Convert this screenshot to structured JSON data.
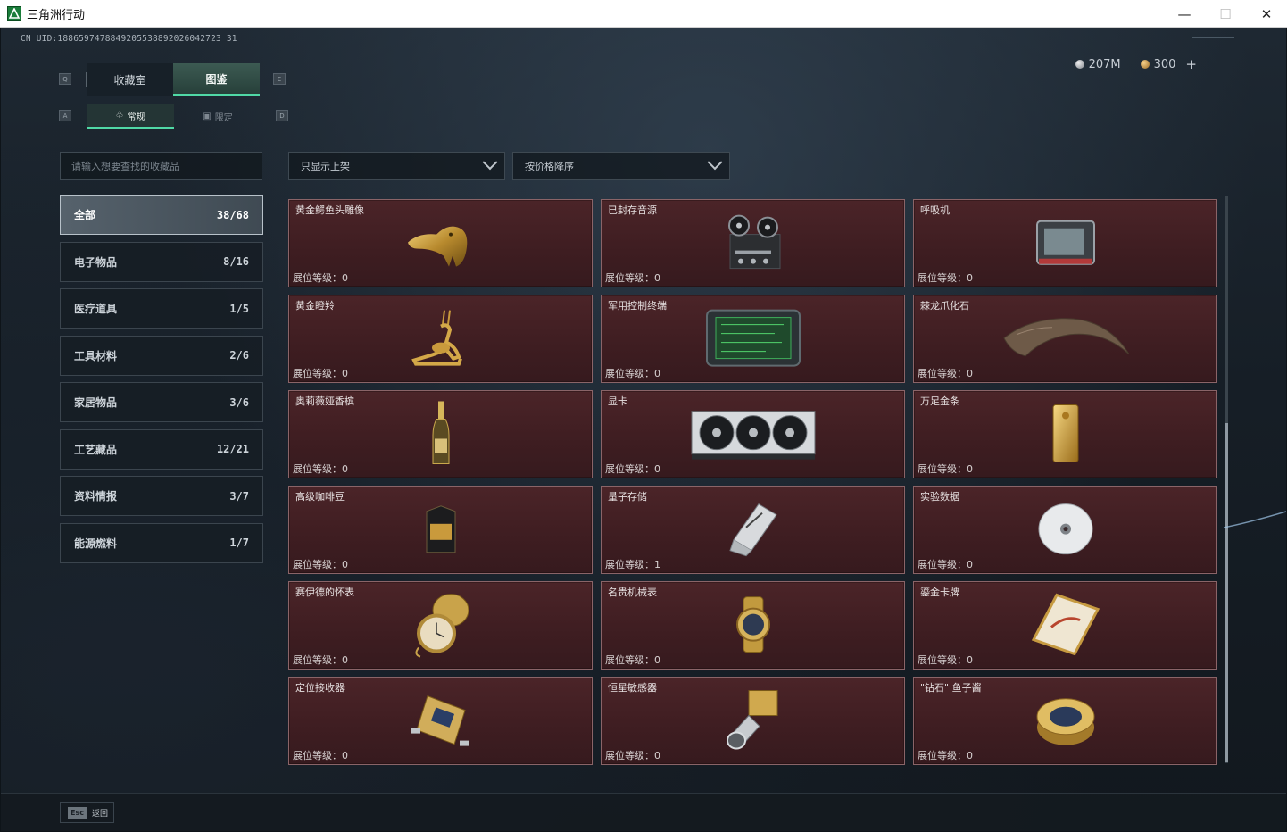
{
  "window": {
    "title": "三角洲行动",
    "minimize": "—",
    "maximize": "☐",
    "close": "✕"
  },
  "header": {
    "uid": "CN UID:1886597478849205538892026042723 31",
    "currency": [
      {
        "icon": "silver-coin-icon",
        "value": "207M"
      },
      {
        "icon": "gold-coin-icon",
        "value": "300"
      }
    ],
    "plus": "+"
  },
  "keys": {
    "q": "Q",
    "e": "E",
    "a": "A",
    "d": "D"
  },
  "main_tabs": [
    {
      "label": "收藏室",
      "active": false
    },
    {
      "label": "图鉴",
      "active": true
    }
  ],
  "sub_tabs": [
    {
      "label": "常规",
      "active": true
    },
    {
      "label": "限定",
      "active": false
    }
  ],
  "search": {
    "placeholder": "请输入想要查找的收藏品"
  },
  "categories": [
    {
      "label": "全部",
      "count": "38/68",
      "active": true
    },
    {
      "label": "电子物品",
      "count": "8/16"
    },
    {
      "label": "医疗道具",
      "count": "1/5"
    },
    {
      "label": "工具材料",
      "count": "2/6"
    },
    {
      "label": "家居物品",
      "count": "3/6"
    },
    {
      "label": "工艺藏品",
      "count": "12/21"
    },
    {
      "label": "资料情报",
      "count": "3/7"
    },
    {
      "label": "能源燃料",
      "count": "1/7"
    }
  ],
  "filters": {
    "show": "只显示上架",
    "sort": "按价格降序"
  },
  "items": [
    {
      "name": "黄金鳄鱼头雕像",
      "level": "展位等级：0",
      "icon": "golden-crocodile-head-icon"
    },
    {
      "name": "已封存音源",
      "level": "展位等级：0",
      "icon": "reel-recorder-icon"
    },
    {
      "name": "呼吸机",
      "level": "展位等级：0",
      "icon": "ventilator-icon"
    },
    {
      "name": "黄金瞪羚",
      "level": "展位等级：0",
      "icon": "golden-gazelle-icon"
    },
    {
      "name": "军用控制终端",
      "level": "展位等级：0",
      "icon": "military-terminal-icon"
    },
    {
      "name": "棘龙爪化石",
      "level": "展位等级：0",
      "icon": "claw-fossil-icon"
    },
    {
      "name": "奥莉薇娅香槟",
      "level": "展位等级：0",
      "icon": "champagne-bottle-icon"
    },
    {
      "name": "显卡",
      "level": "展位等级：0",
      "icon": "graphics-card-icon"
    },
    {
      "name": "万足金条",
      "level": "展位等级：0",
      "icon": "gold-bar-icon"
    },
    {
      "name": "高级咖啡豆",
      "level": "展位等级：0",
      "icon": "coffee-bag-icon"
    },
    {
      "name": "量子存储",
      "level": "展位等级：1",
      "icon": "quantum-storage-icon"
    },
    {
      "name": "实验数据",
      "level": "展位等级：0",
      "icon": "data-disc-icon"
    },
    {
      "name": "赛伊德的怀表",
      "level": "展位等级：0",
      "icon": "pocket-watch-icon"
    },
    {
      "name": "名贵机械表",
      "level": "展位等级：0",
      "icon": "wrist-watch-icon"
    },
    {
      "name": "鎏金卡牌",
      "level": "展位等级：0",
      "icon": "gilded-card-icon"
    },
    {
      "name": "定位接收器",
      "level": "展位等级：0",
      "icon": "locator-receiver-icon"
    },
    {
      "name": "恒星敏感器",
      "level": "展位等级：0",
      "icon": "star-sensor-icon"
    },
    {
      "name": "\"钻石\" 鱼子酱",
      "level": "展位等级：0",
      "icon": "caviar-tin-icon"
    }
  ],
  "footer": {
    "esc_key": "Esc",
    "back_label": "返回"
  },
  "colors": {
    "accent": "#50d9a6",
    "card_bg": "#4b2428",
    "card_border": "#8a6468"
  }
}
